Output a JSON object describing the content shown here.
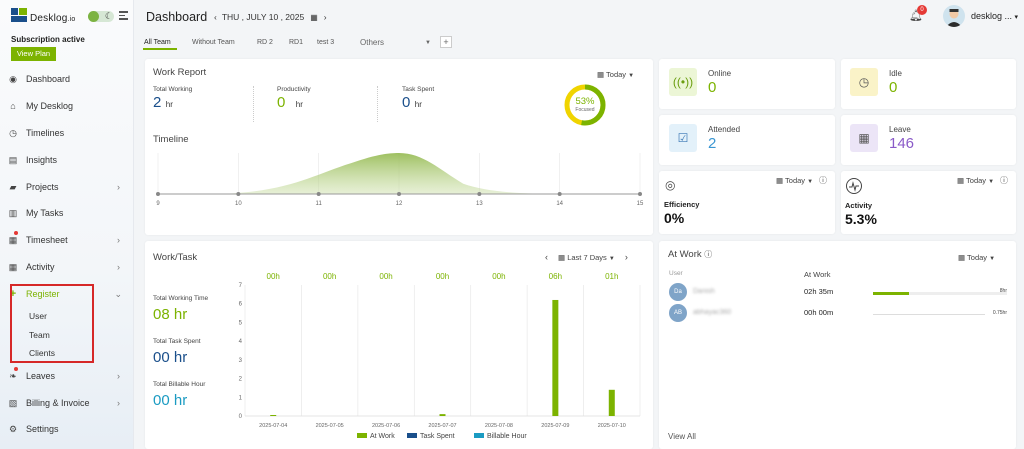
{
  "app": {
    "brand": "Desklog",
    "brand_suffix": ".io",
    "subscription": "Subscription active",
    "view_plan": "View Plan"
  },
  "nav": [
    {
      "label": "Dashboard",
      "icon": "dashboard-icon"
    },
    {
      "label": "My Desklog",
      "icon": "home-icon"
    },
    {
      "label": "Timelines",
      "icon": "clock-icon"
    },
    {
      "label": "Insights",
      "icon": "insights-icon"
    },
    {
      "label": "Projects",
      "icon": "briefcase-icon"
    },
    {
      "label": "My Tasks",
      "icon": "tasks-icon"
    },
    {
      "label": "Timesheet",
      "icon": "calendar-icon"
    },
    {
      "label": "Activity",
      "icon": "grid-icon"
    },
    {
      "label": "Register",
      "icon": "plus-icon"
    },
    {
      "label": "Leaves",
      "icon": "leaves-icon"
    },
    {
      "label": "Billing & Invoice",
      "icon": "billing-icon"
    },
    {
      "label": "Settings",
      "icon": "gear-icon"
    }
  ],
  "register_sub": [
    "User",
    "Team",
    "Clients"
  ],
  "header": {
    "title": "Dashboard",
    "date": "THU , JULY 10 , 2025",
    "notifications": "0",
    "user": "desklog ..."
  },
  "tabs": [
    "All Team",
    "Without Team",
    "RD 2",
    "RD1",
    "test 3"
  ],
  "tab_others": "Others",
  "work_report": {
    "title": "Work Report",
    "range": "Today",
    "stats": [
      {
        "label": "Total Working",
        "value": "2",
        "unit": "hr",
        "color": "#1a4f8b"
      },
      {
        "label": "Productivity",
        "value": "0",
        "unit": "hr",
        "color": "#7cb300"
      },
      {
        "label": "Task Spent",
        "value": "0",
        "unit": "hr",
        "color": "#1a4f8b"
      }
    ],
    "focused_pct": "53%",
    "focused_label": "Focused",
    "timeline_title": "Timeline",
    "timeline_ticks": [
      "9",
      "10",
      "11",
      "12",
      "13",
      "14",
      "15"
    ]
  },
  "tiles": [
    {
      "label": "Online",
      "value": "0",
      "color": "#7cb300",
      "icon": "broadcast-icon"
    },
    {
      "label": "Idle",
      "value": "0",
      "color": "#7cb300",
      "icon": "clock-icon"
    },
    {
      "label": "Attended",
      "value": "2",
      "color": "#3a96d2",
      "icon": "check-icon"
    },
    {
      "label": "Leave",
      "value": "146",
      "color": "#8a5ac8",
      "icon": "calendar-icon"
    }
  ],
  "efficiency": {
    "label": "Efficiency",
    "value": "0%",
    "range": "Today"
  },
  "activity": {
    "label": "Activity",
    "value": "5.3%",
    "range": "Today"
  },
  "work_task": {
    "title": "Work/Task",
    "range": "Last 7 Days",
    "stats": [
      {
        "label": "Total Working Time",
        "value": "08 hr",
        "color": "#7cb300"
      },
      {
        "label": "Total Task Spent",
        "value": "00 hr",
        "color": "#1a4f8b"
      },
      {
        "label": "Total Billable Hour",
        "value": "00 hr",
        "color": "#1b9bc2"
      }
    ],
    "legend": [
      "At Work",
      "Task Spent",
      "Billable Hour"
    ]
  },
  "at_work": {
    "title": "At Work",
    "range": "Today",
    "col_user": "User",
    "col_at_work": "At Work",
    "rows": [
      {
        "initials": "Da",
        "name": "Danish",
        "time": "02h 35m",
        "hours": "8hr"
      },
      {
        "initials": "AB",
        "name": "abhayac360",
        "time": "00h 00m",
        "hours": "0.75hr"
      }
    ],
    "view_all": "View All"
  },
  "chart_data": [
    {
      "type": "area",
      "title": "Timeline",
      "x": [
        9,
        10,
        11,
        12,
        13,
        14,
        15
      ],
      "y": [
        0,
        0.05,
        0.55,
        1.0,
        0.2,
        0,
        0
      ],
      "xlim": [
        9,
        15
      ]
    },
    {
      "type": "bar",
      "categories": [
        "2025-07-04",
        "2025-07-05",
        "2025-07-06",
        "2025-07-07",
        "2025-07-08",
        "2025-07-09",
        "2025-07-10"
      ],
      "top_labels": [
        "00h",
        "00h",
        "00h",
        "00h",
        "00h",
        "06h",
        "01h"
      ],
      "series": [
        {
          "name": "At Work",
          "values": [
            0.05,
            0,
            0,
            0.1,
            0,
            6.2,
            1.4
          ],
          "color": "#7cb300"
        },
        {
          "name": "Task Spent",
          "values": [
            0,
            0,
            0,
            0,
            0,
            0,
            0
          ],
          "color": "#1a4f8b"
        },
        {
          "name": "Billable Hour",
          "values": [
            0,
            0,
            0,
            0,
            0,
            0,
            0
          ],
          "color": "#1b9bc2"
        }
      ],
      "ylim": [
        0,
        7
      ],
      "yticks": [
        0,
        1,
        2,
        3,
        4,
        5,
        6,
        7
      ],
      "grid": true,
      "legend": "bottom"
    }
  ]
}
